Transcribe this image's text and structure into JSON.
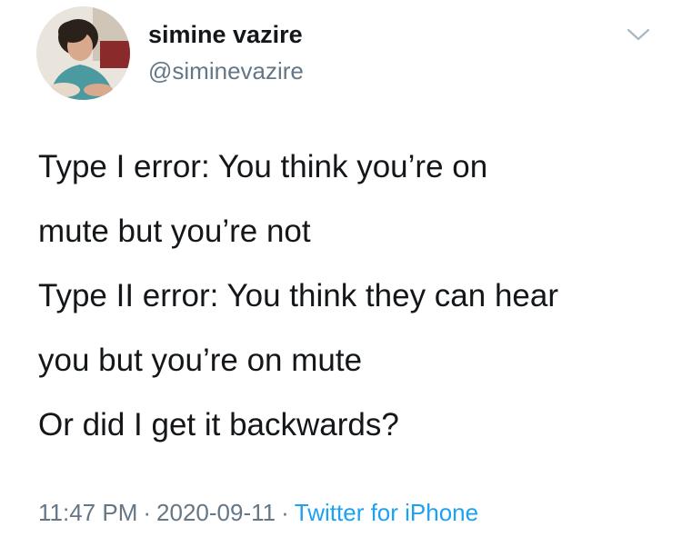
{
  "author": {
    "display_name": "simine vazire",
    "handle": "@siminevazire",
    "avatar_icon": "profile-photo"
  },
  "menu": {
    "icon": "chevron-down-icon"
  },
  "tweet": {
    "lines": [
      "Type I error: You think you’re on",
      "mute but you’re not",
      "Type II error: You think they can hear",
      "you but you’re on mute",
      "Or did I get it backwards?"
    ]
  },
  "meta": {
    "time": "11:47 PM",
    "separator": "·",
    "date": "2020-09-11",
    "source": "Twitter for iPhone"
  },
  "colors": {
    "text": "#14171a",
    "secondary": "#657786",
    "link": "#1da1f2"
  }
}
